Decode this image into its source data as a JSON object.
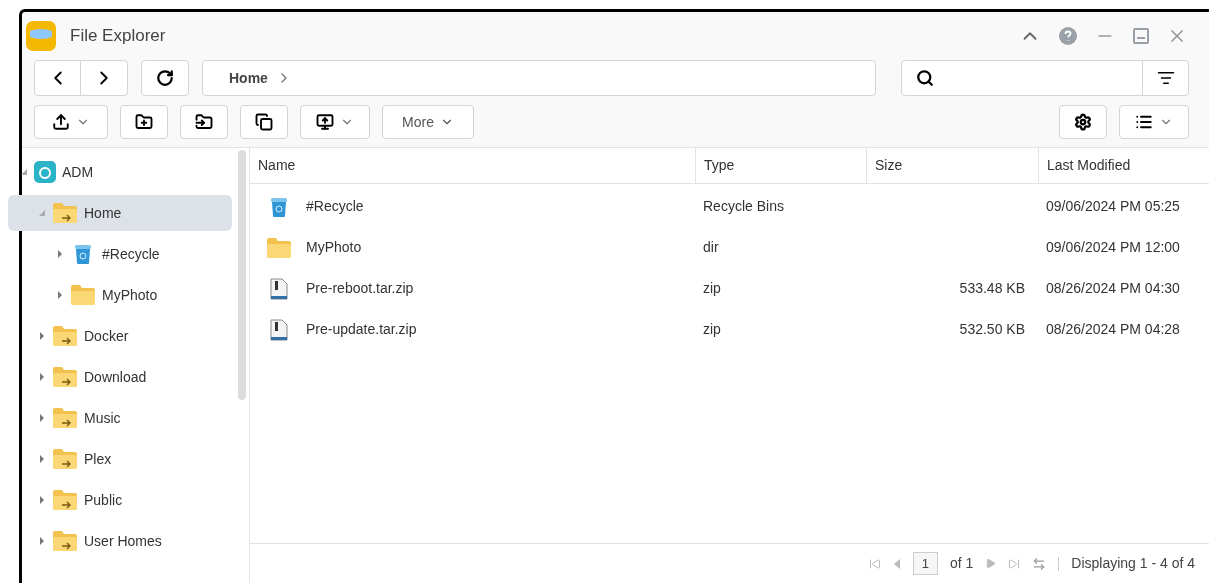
{
  "window": {
    "title": "File Explorer"
  },
  "breadcrumb": [
    {
      "label": "Home"
    }
  ],
  "toolbar": {
    "more_label": "More"
  },
  "tree": [
    {
      "label": "ADM",
      "kind": "nas",
      "expanded": true,
      "selected": false,
      "children": [
        {
          "label": "Home",
          "kind": "share",
          "expanded": true,
          "selected": true,
          "children": [
            {
              "label": "#Recycle",
              "kind": "recycle",
              "expanded": false,
              "selected": false
            },
            {
              "label": "MyPhoto",
              "kind": "folder",
              "expanded": false,
              "selected": false
            }
          ]
        },
        {
          "label": "Docker",
          "kind": "share",
          "expanded": false,
          "selected": false
        },
        {
          "label": "Download",
          "kind": "share",
          "expanded": false,
          "selected": false
        },
        {
          "label": "Music",
          "kind": "share",
          "expanded": false,
          "selected": false
        },
        {
          "label": "Plex",
          "kind": "share",
          "expanded": false,
          "selected": false
        },
        {
          "label": "Public",
          "kind": "share",
          "expanded": false,
          "selected": false
        },
        {
          "label": "User Homes",
          "kind": "share",
          "expanded": false,
          "selected": false
        }
      ]
    }
  ],
  "table": {
    "columns": [
      "Name",
      "Type",
      "Size",
      "Last Modified"
    ],
    "rows": [
      {
        "kind": "recycle",
        "name": "#Recycle",
        "type": "Recycle Bins",
        "modified": "09/06/2024 PM 05:25"
      },
      {
        "kind": "folder",
        "name": "MyPhoto",
        "type": "dir",
        "modified": "09/06/2024 PM 12:00"
      },
      {
        "kind": "zip",
        "name": "Pre-reboot.tar.zip",
        "type": "zip",
        "size": "533.48 KB",
        "modified": "08/26/2024 PM 04:30"
      },
      {
        "kind": "zip",
        "name": "Pre-update.tar.zip",
        "type": "zip",
        "size": "532.50 KB",
        "modified": "08/26/2024 PM 04:28"
      }
    ]
  },
  "pager": {
    "page": "1",
    "of": "of 1",
    "summary": "Displaying 1 - 4 of 4"
  }
}
